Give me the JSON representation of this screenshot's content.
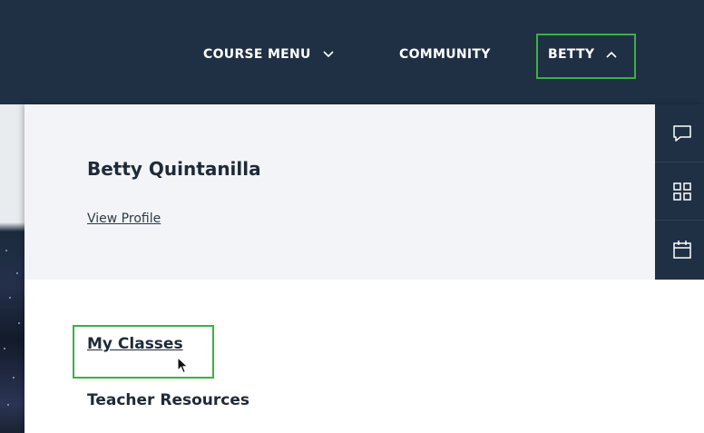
{
  "nav": {
    "course_menu_label": "COURSE MENU",
    "community_label": "COMMUNITY",
    "user_label": "BETTY"
  },
  "profile": {
    "name": "Betty Quintanilla",
    "view_profile_label": "View Profile"
  },
  "menu": {
    "items": [
      {
        "label": "My Classes"
      },
      {
        "label": "Teacher Resources"
      }
    ]
  },
  "side_rail": {
    "icons": [
      "chat-icon",
      "grid-icon",
      "calendar-icon"
    ]
  },
  "colors": {
    "nav_bg": "#1f3045",
    "panel_bg": "#f2f4f7",
    "focus": "#3cb043",
    "text": "#1f2a38"
  }
}
